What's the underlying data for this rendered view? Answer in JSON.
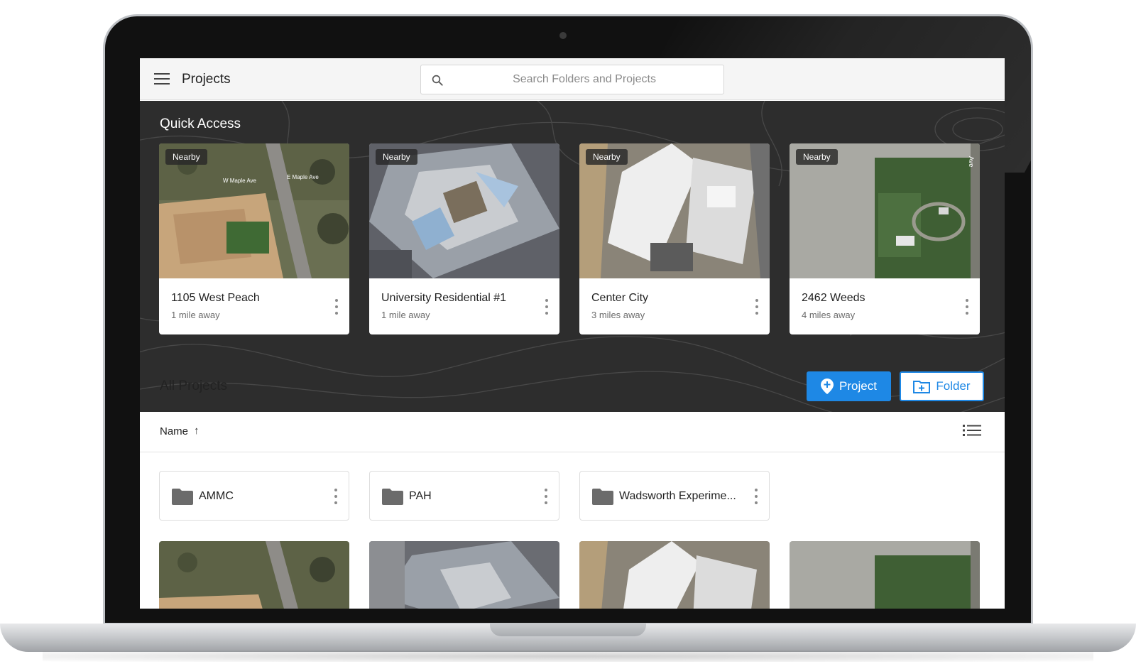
{
  "topbar": {
    "title": "Projects",
    "search_placeholder": "Search Folders and Projects",
    "icons": [
      "menu-icon",
      "search-icon"
    ]
  },
  "quick_access": {
    "title": "Quick Access",
    "cards": [
      {
        "badge": "Nearby",
        "name": "1105 West Peach",
        "distance": "1 mile away",
        "map_labels": [
          "W Maple Ave",
          "E Maple Ave"
        ]
      },
      {
        "badge": "Nearby",
        "name": "University Residential #1",
        "distance": "1 mile away"
      },
      {
        "badge": "Nearby",
        "name": "Center City",
        "distance": "3 miles away"
      },
      {
        "badge": "Nearby",
        "name": "2462 Weeds",
        "distance": "4 miles away",
        "map_labels": [
          "Ave"
        ]
      }
    ]
  },
  "all_projects": {
    "title": "All Projects",
    "project_button": "Project",
    "folder_button": "Folder",
    "sort_label": "Name",
    "sort_arrow": "↑",
    "folders": [
      {
        "name": "AMMC"
      },
      {
        "name": "PAH"
      },
      {
        "name": "Wadsworth Experime..."
      }
    ]
  },
  "colors": {
    "accent": "#1e88e5",
    "quick_access_bg": "#2d2d2d",
    "topbar_bg": "#f5f5f5"
  }
}
